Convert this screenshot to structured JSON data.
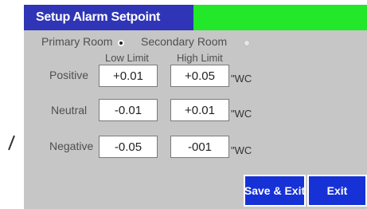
{
  "header": {
    "title": "Setup Alarm Setpoint",
    "status_color": "#22e829"
  },
  "room": {
    "primary_label": "Primary Room",
    "secondary_label": "Secondary Room",
    "selected": "primary"
  },
  "columns": {
    "low": "Low Limit",
    "high": "High Limit"
  },
  "rows": [
    {
      "label": "Positive",
      "low": "+0.01",
      "high": "+0.05",
      "unit": "\"WC"
    },
    {
      "label": "Neutral",
      "low": "-0.01",
      "high": "+0.01",
      "unit": "\"WC"
    },
    {
      "label": "Negative",
      "low": "-0.05",
      "high": "-001",
      "unit": "\"WC"
    }
  ],
  "buttons": {
    "save_exit": "Save & Exit",
    "exit": "Exit"
  }
}
